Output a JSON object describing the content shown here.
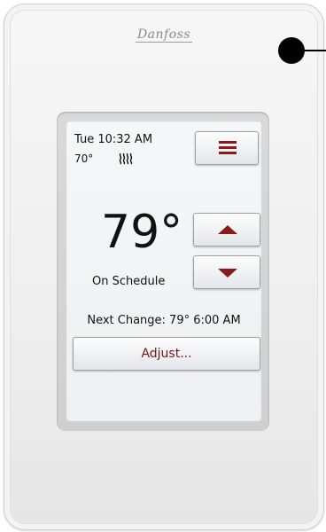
{
  "device": {
    "brand": "Danfoss"
  },
  "status": {
    "date_time": "Tue 10:32 AM",
    "current_temp": "70°",
    "heating_icon": "heat-waves-icon"
  },
  "menu": {
    "icon": "menu-icon"
  },
  "setpoint": {
    "value": "79°",
    "mode": "On Schedule"
  },
  "controls": {
    "up_icon": "up-arrow-icon",
    "down_icon": "down-arrow-icon"
  },
  "schedule": {
    "next_change": "Next Change: 79° 6:00 AM"
  },
  "adjust": {
    "label": "Adjust..."
  },
  "colors": {
    "accent": "#8b1a1a",
    "indicator": "#000000"
  }
}
